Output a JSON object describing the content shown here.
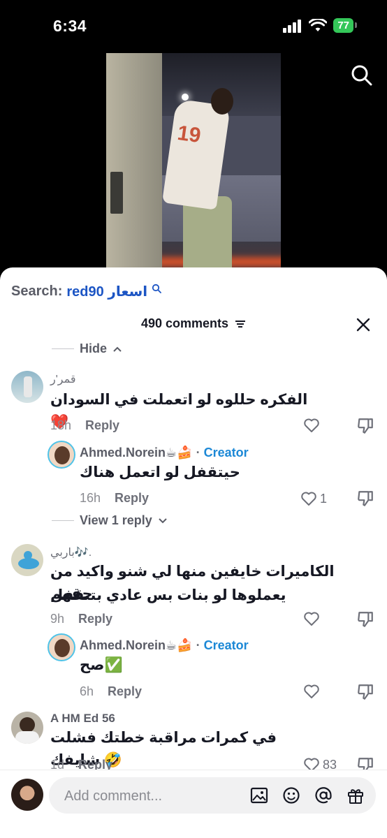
{
  "status": {
    "time": "6:34",
    "battery": "77"
  },
  "sheet": {
    "search_prefix": "Search:",
    "search_query": "red90 اسعار",
    "comments_count": "490 comments",
    "hide_label": "Hide",
    "view_reply_label": "View 1 reply"
  },
  "comments": [
    {
      "user": "قمر'ر",
      "text": "الفكره حللوه لو اتعملت في السودان❤️",
      "age": "18h",
      "reply": "Reply",
      "reply_item": {
        "user": "Ahmed.Norein☕🍰",
        "badge": "Creator",
        "text": "حيتقفل لو اتعمل هناك",
        "age": "16h",
        "reply": "Reply",
        "likes": "1"
      }
    },
    {
      "user": "باربي🎶.",
      "text_line1": "الكاميرات خايفين منها لي شنو واكيد من حقهم",
      "text_line2": "يعملوها لو بنات بس عادي بتتقفل",
      "age": "9h",
      "reply": "Reply",
      "reply_item": {
        "user": "Ahmed.Norein☕🍰",
        "badge": "Creator",
        "text": "صح✅",
        "age": "6h",
        "reply": "Reply"
      }
    },
    {
      "user": "A HM Ed 56",
      "text": "في كمرات مراقبة خطتك فشلت شايفك 🤣",
      "age": "1d",
      "reply": "Reply",
      "likes": "83"
    }
  ],
  "composer": {
    "placeholder": "Add comment..."
  },
  "icons": [
    "search-icon",
    "close-icon",
    "heart-icon",
    "dislike-icon",
    "image-icon",
    "emoji-icon",
    "mention-icon",
    "gift-icon"
  ]
}
